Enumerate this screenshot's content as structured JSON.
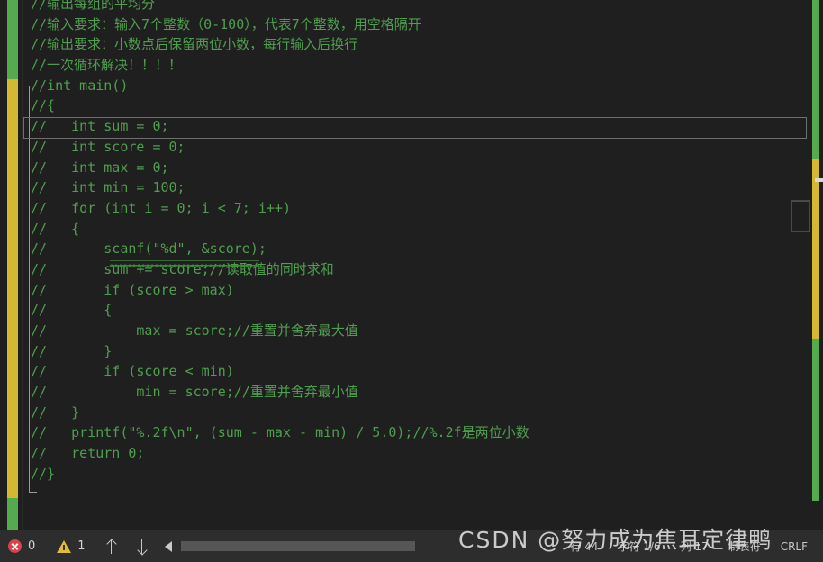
{
  "app": {
    "theme_bg": "#1f1f1f",
    "comment_color": "#4f9e4f",
    "change_bar_modified": "#d4b832",
    "change_bar_saved": "#55aa50"
  },
  "editor": {
    "lines": [
      "//输出每组的平均分",
      "//输入要求：输入7个整数（0-100），代表7个整数，用空格隔开",
      "//输出要求：小数点后保留两位小数，每行输入后换行",
      "//一次循环解决！！！！",
      "//int main()",
      "//{",
      "//   int sum = 0;",
      "//   int score = 0;",
      "//   int max = 0;",
      "//   int min = 100;",
      "//   for (int i = 0; i < 7; i++)",
      "//   {",
      "//       scanf(\"%d\", &score);",
      "//       sum += score;//读取值的同时求和",
      "//       if (score > max)",
      "//       {",
      "//           max = score;//重置并舍弃最大值",
      "//       }",
      "//       if (score < min)",
      "//           min = score;//重置并舍弃最小值",
      "//   }",
      "//   printf(\"%.2f\\n\", (sum - max - min) / 5.0);//%.2f是两位小数",
      "//   return 0;",
      "//}"
    ],
    "current_line_index": 6,
    "squiggle_line_index": 12
  },
  "statusbar": {
    "error_count": "0",
    "warning_count": "1",
    "prev_label": "↑",
    "next_label": "↓",
    "fields": [
      "行 44",
      "字符 1/6",
      "列 17",
      "制表符",
      "CRLF"
    ]
  },
  "watermark": {
    "prefix": "CSDN",
    "handle": "@努力成为焦耳定律鸭"
  }
}
